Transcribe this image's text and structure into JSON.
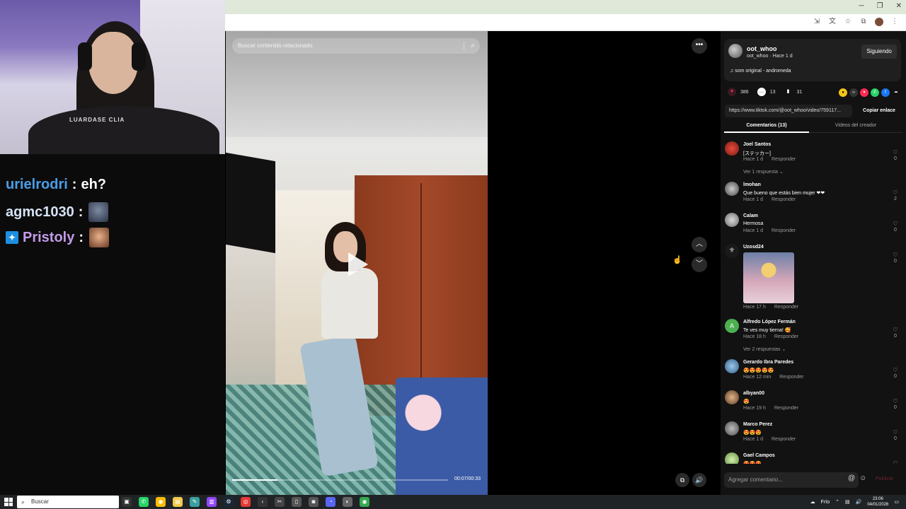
{
  "stream_chat": {
    "messages": [
      {
        "user": "urielrodri",
        "sep": ":",
        "text": "eh?",
        "user_color": "#4a9ee8"
      },
      {
        "user": "agmc1030",
        "sep": ":",
        "text": "",
        "user_color": "#d6e2f5"
      },
      {
        "user": "Pristoly",
        "sep": ":",
        "text": "",
        "user_color": "#c39ae8"
      }
    ],
    "hoodie_text": "LUARDASE CLIA"
  },
  "window": {
    "minimize": "─",
    "restore": "❐",
    "close": "✕"
  },
  "video": {
    "search_placeholder": "Buscar contenido relacionado",
    "time": "00:07/00:33",
    "progress": 0.21
  },
  "author": {
    "username": "oot_whoo",
    "subline": "oot_whoo · Hace 1 d",
    "follow_label": "Siguiendo",
    "music": "♫  som original - andromeda"
  },
  "stats": {
    "likes": "386",
    "comments": "13",
    "saves": "31"
  },
  "link": {
    "url": "https://www.tiktok.com/@oot_whoo/video/759117...",
    "copy_label": "Copiar enlace"
  },
  "tabs": {
    "comments": "Comentarios (13)",
    "creator_videos": "Videos del creador"
  },
  "comments": [
    {
      "name": "Joel Santos",
      "text": "[ステッカー]",
      "time": "Hace 1 d",
      "reply": "Responder",
      "likes": "0",
      "more": "Ver 1 respuesta ⌄",
      "avatar_color": "#c0392b"
    },
    {
      "name": "lmohan",
      "text": "Que bueno que estás bien mujer ❤❤",
      "time": "Hace 1 d",
      "reply": "Responder",
      "likes": "2",
      "more": "",
      "avatar_color": "#6b6b6b"
    },
    {
      "name": "Calam",
      "text": "Hermosa",
      "time": "Hace 1 d",
      "reply": "Responder",
      "likes": "0",
      "more": "",
      "avatar_color": "#8a8a8a"
    },
    {
      "name": "Uzosd24",
      "text": "",
      "time": "Hace 17 h",
      "reply": "Responder",
      "likes": "0",
      "more": "",
      "avatar_color": "#2a2a2a"
    },
    {
      "name": "Alfredo López Fermán",
      "text": "Te ves muy tierna! 🥰",
      "time": "Hace 18 h",
      "reply": "Responder",
      "likes": "0",
      "more": "Ver 2 respuestas ⌄",
      "avatar_color": "#4caf50"
    },
    {
      "name": "Gerardo Ibra Paredes",
      "text": "😍😍😍😍😍",
      "time": "Hace 12 min",
      "reply": "Responder",
      "likes": "0",
      "more": "",
      "avatar_color": "#5d8fb8"
    },
    {
      "name": "albyan00",
      "text": "😍",
      "time": "Hace 19 h",
      "reply": "Responder",
      "likes": "0",
      "more": "",
      "avatar_color": "#a07050"
    },
    {
      "name": "Marco Perez",
      "text": "😍😍😍",
      "time": "Hace 1 d",
      "reply": "Responder",
      "likes": "0",
      "more": "",
      "avatar_color": "#7a7a7a"
    },
    {
      "name": "Gael Campos",
      "text": "😍😍😍",
      "time": "",
      "reply": "",
      "likes": "",
      "more": "",
      "avatar_color": "#8fbf6f"
    }
  ],
  "comment_input": {
    "placeholder": "Agregar comentario...",
    "post_label": "Publicar"
  },
  "taskbar": {
    "search_label": "Buscar",
    "weather": "Frío",
    "time": "23:06",
    "date": "04/01/2026"
  }
}
